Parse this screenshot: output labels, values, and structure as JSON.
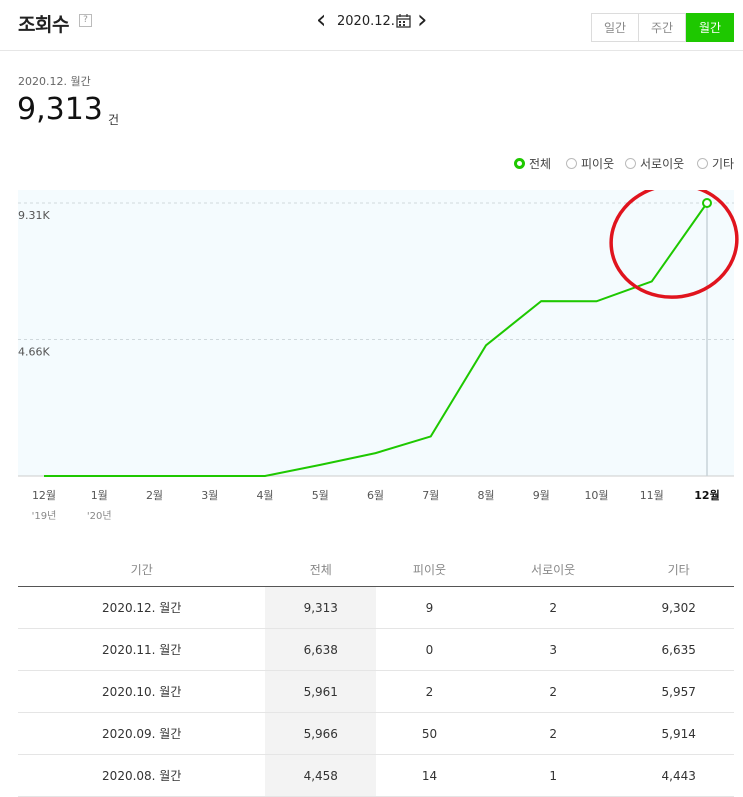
{
  "header": {
    "title": "조회수",
    "help": "?",
    "date": "2020.12.",
    "tabs": [
      "일간",
      "주간",
      "월간"
    ],
    "active_tab": "월간"
  },
  "summary": {
    "period": "2020.12. 월간",
    "total": "9,313",
    "unit": "건"
  },
  "filters": [
    {
      "label": "전체",
      "checked": true
    },
    {
      "label": "피이웃",
      "checked": false
    },
    {
      "label": "서로이웃",
      "checked": false
    },
    {
      "label": "기타",
      "checked": false
    }
  ],
  "colors": {
    "accent": "#1ec800",
    "annotation": "#e0141e"
  },
  "chart_data": {
    "type": "line",
    "x": [
      "12월",
      "1월",
      "2월",
      "3월",
      "4월",
      "5월",
      "6월",
      "7월",
      "8월",
      "9월",
      "10월",
      "11월",
      "12월"
    ],
    "x_sub": [
      "'19년",
      "'20년",
      "",
      "",
      "",
      "",
      "",
      "",
      "",
      "",
      "",
      "",
      ""
    ],
    "series": [
      {
        "values": [
          0,
          0,
          0,
          0,
          0,
          380,
          780,
          1350,
          4458,
          5966,
          5961,
          6638,
          9313
        ]
      }
    ],
    "y_ticks": [
      "9.31K",
      "4.66K"
    ],
    "ylim": [
      0,
      9313
    ],
    "highlight_index": 12,
    "grid": true
  },
  "table": {
    "headers": [
      "기간",
      "전체",
      "피이웃",
      "서로이웃",
      "기타"
    ],
    "rows": [
      [
        "2020.12. 월간",
        "9,313",
        "9",
        "2",
        "9,302"
      ],
      [
        "2020.11. 월간",
        "6,638",
        "0",
        "3",
        "6,635"
      ],
      [
        "2020.10. 월간",
        "5,961",
        "2",
        "2",
        "5,957"
      ],
      [
        "2020.09. 월간",
        "5,966",
        "50",
        "2",
        "5,914"
      ],
      [
        "2020.08. 월간",
        "4,458",
        "14",
        "1",
        "4,443"
      ]
    ]
  }
}
